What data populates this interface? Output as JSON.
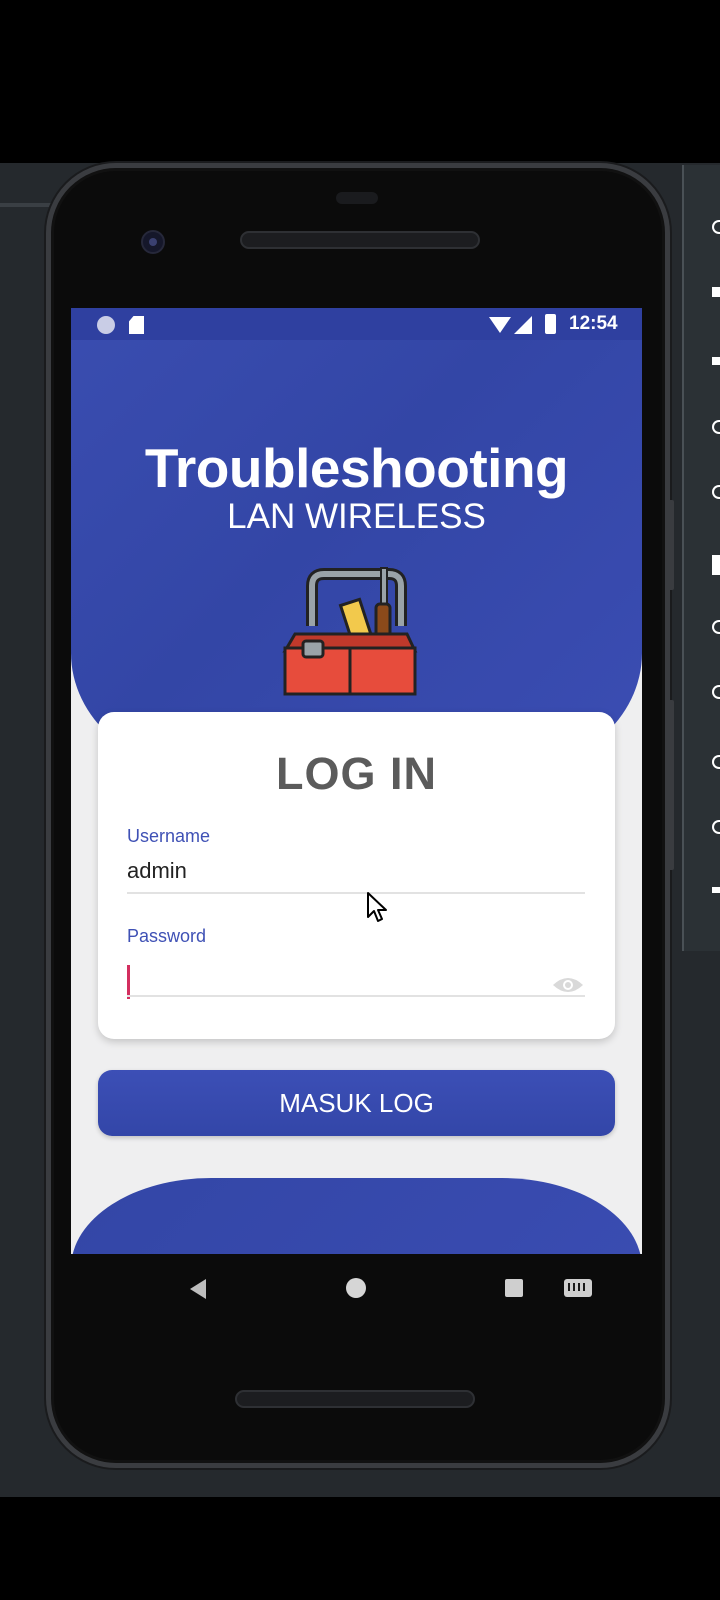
{
  "status_bar": {
    "time": "12:54",
    "left_icons": [
      "notification-dot-icon",
      "sd-card-icon"
    ],
    "right_icons": [
      "wifi-icon",
      "cell-signal-icon",
      "battery-icon"
    ]
  },
  "header": {
    "title": "Troubleshooting",
    "subtitle": "LAN WIRELESS",
    "logo_icon": "toolbox-icon"
  },
  "login": {
    "title": "LOG IN",
    "username_label": "Username",
    "username_value": "admin",
    "password_label": "Password",
    "password_value": "",
    "password_toggle_icon": "eye-icon"
  },
  "actions": {
    "submit_label": "MASUK LOG"
  },
  "nav_bar": {
    "buttons": [
      "back-icon",
      "home-icon",
      "recents-icon",
      "keyboard-icon"
    ]
  },
  "colors": {
    "primary": "#3346A6",
    "status_bar": "#2F40A0",
    "accent_label": "#3F51B5",
    "caret": "#D32F5F",
    "background": "#EFEFF0"
  }
}
